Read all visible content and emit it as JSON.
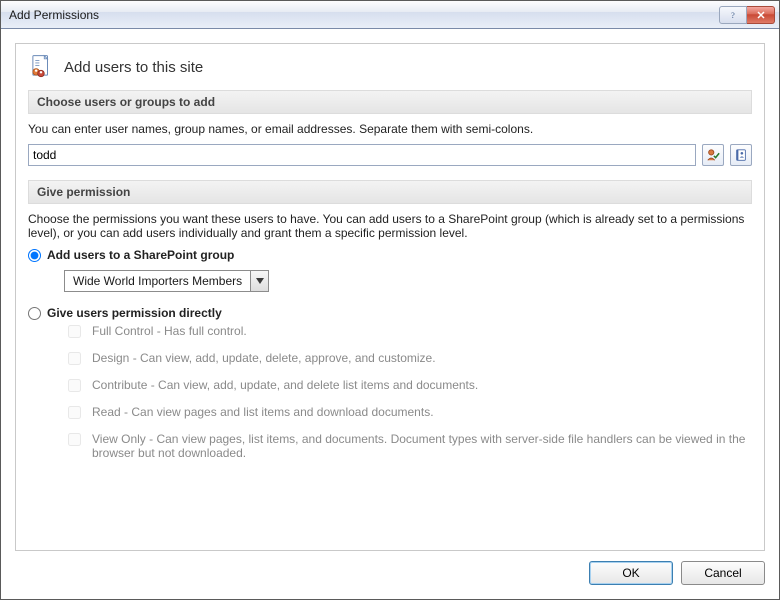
{
  "window": {
    "title": "Add Permissions"
  },
  "header": {
    "text": "Add users to this site"
  },
  "section1": {
    "title": "Choose users or groups to add",
    "instruction": "You can enter user names, group names, or email addresses. Separate them with semi-colons.",
    "input_value": "todd"
  },
  "section2": {
    "title": "Give permission",
    "instruction": "Choose the permissions you want these users to have.  You can add users to a SharePoint group (which is already set to a permissions level), or you can add users individually and grant them a specific permission level.",
    "radio_group": {
      "group_label": "Add users to a SharePoint group",
      "group_selected": "Wide World Importers Members",
      "direct_label": "Give users permission directly"
    },
    "permissions": [
      {
        "label": "Full Control - Has full control."
      },
      {
        "label": "Design - Can view, add, update, delete, approve, and customize."
      },
      {
        "label": "Contribute - Can view, add, update, and delete list items and documents."
      },
      {
        "label": "Read - Can view pages and list items and download documents."
      },
      {
        "label": "View Only - Can view pages, list items, and documents. Document types with server-side file handlers can be viewed in the browser but not downloaded."
      }
    ]
  },
  "buttons": {
    "ok": "OK",
    "cancel": "Cancel"
  }
}
